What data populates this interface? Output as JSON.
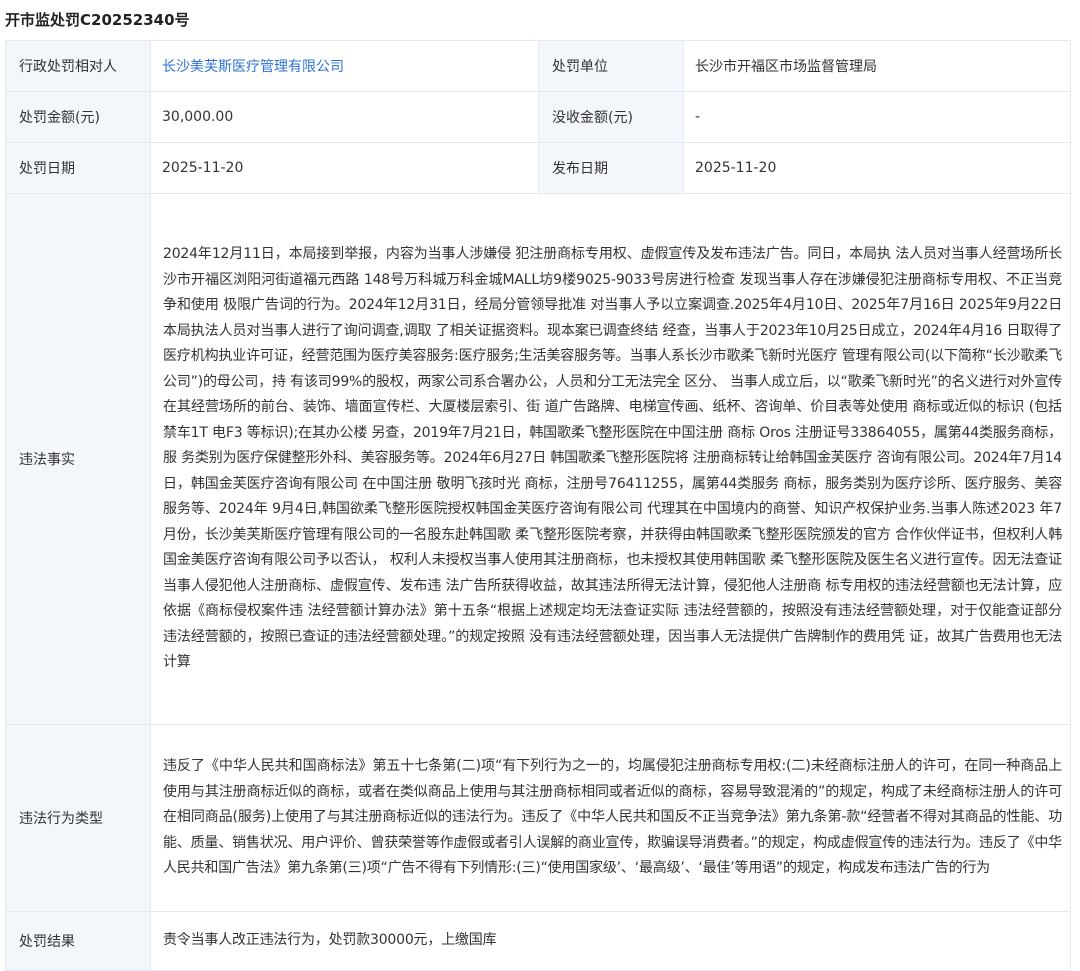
{
  "document": {
    "title": "开市监处罚C20252340号"
  },
  "table": {
    "party_label": "行政处罚相对人",
    "party_value": "长沙美芙斯医疗管理有限公司",
    "unit_label": "处罚单位",
    "unit_value": "长沙市开福区市场监督管理局",
    "amount_label": "处罚金额(元)",
    "amount_value": "30,000.00",
    "confiscation_label": "没收金额(元)",
    "confiscation_value": "-",
    "date_label": "处罚日期",
    "date_value": "2025-11-20",
    "publish_label": "发布日期",
    "publish_value": "2025-11-20",
    "facts_label": "违法事实",
    "facts_value": "2024年12月11日，本局接到举报，内容为当事人涉嫌侵 犯注册商标专用权、虚假宣传及发布违法广告。同日，本局执 法人员对当事人经营场所长沙市开福区浏阳河街道福元西路 148号万科城万科金城MALL坊9楼9025-9033号房进行检查 发现当事人存在涉嫌侵犯注册商标专用权、不正当竞争和使用 极限广告词的行为。2024年12月31日，经局分管领导批准 对当事人予以立案调查.2025年4月10日、2025年7月16日 2025年9月22日本局执法人员对当事人进行了询问调查,调取 了相关证据资料。现本案已调查终结 经查，当事人于2023年10月25日成立，2024年4月16 日取得了医疗机构执业许可证，经营范围为医疗美容服务:医疗服务;生活美容服务等。当事人系长沙市歌柔飞新时光医疗 管理有限公司(以下简称“长沙歌柔飞公司”)的母公司，持 有该司99%的股权，两家公司系合署办公，人员和分工无法完全 区分、 当事人成立后，以“歌柔飞新时光”的名义进行对外宣传 在其经营场所的前台、装饰、墙面宣传栏、大厦楼层索引、街 道广告路牌、电梯宣传画、纸杯、咨询单、价目表等处使用 商标或近似的标识 (包括 禁车1T 电F3 等标识);在其办公楼 另查，2019年7月21日，韩国歌柔飞整形医院在中国注册 商标 Oros 注册证号33864055，属第44类服务商标，服 务类别为医疗保健整形外科、美容服务等。2024年6月27日 韩国歌柔飞整形医院将 注册商标转让给韩国金芙医疗 咨询有限公司。2024年7月14日，韩国金芙医疗咨询有限公司 在中国注册 敬明飞孩时光 商标，注册号76411255，属第44类服务 商标，服务类别为医疗诊所、医疗服务、美容服务等、2024年 9月4日,韩国欲柔飞整形医院授权韩国金芙医疗咨询有限公司 代理其在中国境内的商誉、知识产权保护业务.当事人陈述2023 年7月份，长沙美芙斯医疗管理有限公司的一名股东赴韩国歌 柔飞整形医院考察，并获得由韩国歌柔飞整形医院颁发的官方 合作伙伴证书，但权利人韩国金美医疗咨询有限公司予以否认， 权利人未授权当事人使用其注册商标，也未授权其使用韩国歌 柔飞整形医院及医生名义进行宣传。因无法查证当事人侵犯他人注册商标、虚假宣传、发布违 法广告所获得收益，故其违法所得无法计算，侵犯他人注册商 标专用权的违法经营额也无法计算，应依据《商标侵权案件违 法经营额计算办法》第十五条“根据上述规定均无法查证实际 违法经营额的，按照没有违法经营额处理，对于仅能查证部分 违法经营额的，按照已查证的违法经营额处理。”的规定按照 没有违法经营额处理，因当事人无法提供广告牌制作的费用凭 证，故其广告费用也无法计算",
    "types_label": "违法行为类型",
    "types_value": "违反了《中华人民共和国商标法》第五十七条第(二)项“有下列行为之一的，均属侵犯注册商标专用权:(二)未经商标注册人的许可，在同一种商品上使用与其注册商标近似的商标，或者在类似商品上使用与其注册商标相同或者近似的商标，容易导致混淆的”的规定，构成了未经商标注册人的许可在相同商品(服务)上使用了与其注册商标近似的违法行为。违反了《中华人民共和国反不正当竞争法》第九条第-款“经营者不得对其商品的性能、功能、质量、销售状况、用户评价、曾获荣誉等作虚假或者引人误解的商业宣传，欺骗误导消费者。”的规定，构成虚假宣传的违法行为。违反了《中华人民共和国广告法》第九条第(三)项“广告不得有下列情形:(三)“使用国家级’、‘最高级’、‘最佳’等用语”的规定，构成发布违法广告的行为",
    "result_label": "处罚结果",
    "result_value": "责令当事人改正违法行为，处罚款30000元，上缴国库"
  },
  "colors": {
    "label_bg": "#f3f6fb",
    "border": "#e4e9f1",
    "link": "#2d73d8",
    "text": "#333333"
  }
}
